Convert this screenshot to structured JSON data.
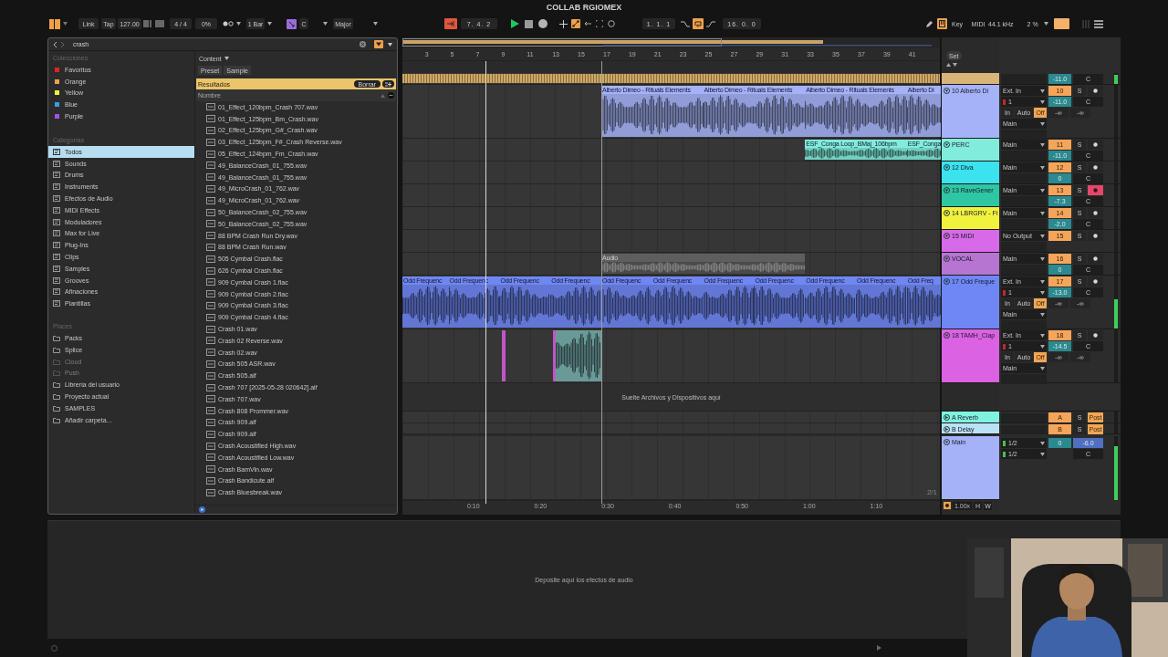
{
  "window": {
    "title": "COLLAB RGIOMEX"
  },
  "toolbar": {
    "link": "Link",
    "tap": "Tap",
    "tempo": "127.00",
    "signature": "4 / 4",
    "groove": "0%",
    "quantization": "1 Bar",
    "key": "C",
    "scale": "Major",
    "position": "7. 4. 2",
    "playing": true,
    "loop_start": "1. 1. 1",
    "loop_on": true,
    "loop_length": "16. 0. 0",
    "key_map": "Key",
    "key_map_on": true,
    "midi_map": "MIDI",
    "sample_rate": "44.1 kHz",
    "cpu": "2 %"
  },
  "browser": {
    "search": "crash",
    "collections_label": "Colecciones",
    "collections": [
      {
        "label": "Favoritos",
        "color": "#e02424"
      },
      {
        "label": "Orange",
        "color": "#f0a24a"
      },
      {
        "label": "Yellow",
        "color": "#f2f23c"
      },
      {
        "label": "Blue",
        "color": "#3a9de2"
      },
      {
        "label": "Purple",
        "color": "#a452e6"
      }
    ],
    "categories_label": "Categorías",
    "categories": [
      {
        "label": "Todos",
        "selected": true
      },
      {
        "label": "Sounds",
        "selected": false
      },
      {
        "label": "Drums",
        "selected": false
      },
      {
        "label": "Instruments",
        "selected": false
      },
      {
        "label": "Efectos de Audio",
        "selected": false
      },
      {
        "label": "MIDI Effects",
        "selected": false
      },
      {
        "label": "Moduladores",
        "selected": false
      },
      {
        "label": "Max for Live",
        "selected": false
      },
      {
        "label": "Plug-Ins",
        "selected": false
      },
      {
        "label": "Clips",
        "selected": false
      },
      {
        "label": "Samples",
        "selected": false
      },
      {
        "label": "Grooves",
        "selected": false
      },
      {
        "label": "Afinaciones",
        "selected": false
      },
      {
        "label": "Plantillas",
        "selected": false
      }
    ],
    "places_label": "Places",
    "places": [
      {
        "label": "Packs",
        "disabled": false
      },
      {
        "label": "Splice",
        "disabled": false
      },
      {
        "label": "Cloud",
        "disabled": true
      },
      {
        "label": "Push",
        "disabled": true
      },
      {
        "label": "Librería del usuario",
        "disabled": false
      },
      {
        "label": "Proyecto actual",
        "disabled": false
      },
      {
        "label": "SAMPLES",
        "disabled": false
      },
      {
        "label": "Añadir carpeta...",
        "disabled": false
      }
    ],
    "content_label": "Content",
    "filters": [
      "Preset",
      "Sample"
    ],
    "results_label": "Resultados",
    "clear_button": "Borrar",
    "column": "Nombre",
    "files": [
      "01_Effect_120bpm_Crash 707.wav",
      "01_Effect_125bpm_Bm_Crash.wav",
      "02_Effect_125bpm_G#_Crash.wav",
      "03_Effect_125bpm_F#_Crash Reverse.wav",
      "05_Effect_124bpm_Fm_Crash.wav",
      "49_BalanceCrash_01_755.wav",
      "49_BalanceCrash_01_755.wav",
      "49_MicroCrash_01_762.wav",
      "49_MicroCrash_01_762.wav",
      "50_BalanceCrash_02_755.wav",
      "50_BalanceCrash_02_755.wav",
      "88 BPM Crash Run Dry.wav",
      "88 BPM Crash Run.wav",
      "505 Cymbal Crash.flac",
      "626 Cymbal Crash.flac",
      "909 Cymbal Crash 1.flac",
      "909 Cymbal Crash 2.flac",
      "909 Cymbal Crash 3.flac",
      "909 Cymbal Crash 4.flac",
      "Crash 01.wav",
      "Crash 02 Reverse.wav",
      "Crash 02.wav",
      "Crash 505 ASR.wav",
      "Crash 505.aif",
      "Crash 707 [2025-05-28 020642].aif",
      "Crash 707.wav",
      "Crash 808 Prommer.wav",
      "Crash 909.aif",
      "Crash 909.aif",
      "Crash Acoustified High.wav",
      "Crash Acoustified Low.wav",
      "Crash BamVin.wav",
      "Crash Bandicute.aif",
      "Crash Bluesbreak.wav"
    ]
  },
  "arrangement": {
    "set_button": "Set",
    "bars": [
      "3",
      "5",
      "7",
      "9",
      "11",
      "13",
      "15",
      "17",
      "19",
      "21",
      "23",
      "25",
      "27",
      "29",
      "31",
      "33",
      "35",
      "37",
      "39",
      "41"
    ],
    "times": [
      "0:10",
      "0:20",
      "0:30",
      "0:40",
      "0:50",
      "1:00",
      "1:10"
    ],
    "drop_hint": "Suelte Archivos y Dispositivos aquí",
    "page": "2/1",
    "zoom": "1.00x",
    "h_button": "H",
    "w_button": "W"
  },
  "group": {
    "color": "#d9b377",
    "volume": "-11.0",
    "pan": "C",
    "level": 0.8
  },
  "tracks": [
    {
      "name": "10 Alberto Di",
      "color": "#a5b2f7",
      "kind": "expanded",
      "input": "Ext. In",
      "channel": "1",
      "monitor": [
        {
          "label": "In",
          "selected": false
        },
        {
          "label": "Auto",
          "selected": false
        },
        {
          "label": "Off",
          "selected": true
        }
      ],
      "output": "Main",
      "number": "10",
      "solo": "S",
      "volume": "-11.0",
      "pan": "C",
      "sends": [
        "-∞",
        "-∞"
      ],
      "armed": false,
      "clips": [
        {
          "name": "Alberto Dimeo - Rituals Elements",
          "active": true
        },
        {
          "name": "Alberto Dimeo - Rituals Elements",
          "active": true
        },
        {
          "name": "Alberto Dimeo - Rituals Elements",
          "active": true
        },
        {
          "name": "Alberto Di",
          "active": true
        }
      ]
    },
    {
      "name": "PERC",
      "color": "#82ecdc",
      "kind": "compact",
      "output": "Main",
      "number": "11",
      "solo": "S",
      "volume": "-11.0",
      "pan": "C",
      "armed": false,
      "clips": [
        {
          "name": "ESF_Conga Loop_BMaj_106bpm",
          "active": true
        },
        {
          "name": "ESF_Conga",
          "active": true
        }
      ]
    },
    {
      "name": "12 Diva",
      "color": "#3ae3ee",
      "kind": "compact",
      "output": "Main",
      "number": "12",
      "solo": "S",
      "volume": "0",
      "pan": "C",
      "armed": false
    },
    {
      "name": "13 RaveGener",
      "color": "#2fc6a4",
      "kind": "compact",
      "output": "Main",
      "number": "13",
      "solo": "S",
      "volume": "-7.3",
      "pan": "C",
      "armed": true
    },
    {
      "name": "14 LBRGRV - Fi",
      "color": "#f1f23e",
      "kind": "compact",
      "output": "Main",
      "number": "14",
      "solo": "S",
      "volume": "-2.0",
      "pan": "C",
      "armed": false
    },
    {
      "name": "15 MIDI",
      "color": "#d66ae8",
      "kind": "compact",
      "output": "No Output",
      "number": "15",
      "solo": "S",
      "armed": false
    },
    {
      "name": "VOCAL",
      "color": "#b675d1",
      "kind": "compact",
      "output": "Main",
      "number": "16",
      "solo": "S",
      "volume": "0",
      "pan": "C",
      "armed": false,
      "clips": [
        {
          "name": "Audio",
          "active": false
        }
      ]
    },
    {
      "name": "17 Odd Freque",
      "color": "#6f87f2",
      "kind": "expanded",
      "input": "Ext. In",
      "channel": "1",
      "monitor": [
        {
          "label": "In",
          "selected": false
        },
        {
          "label": "Auto",
          "selected": false
        },
        {
          "label": "Off",
          "selected": true
        }
      ],
      "output": "Main",
      "number": "17",
      "solo": "S",
      "volume": "-13.0",
      "pan": "C",
      "sends": [
        "-∞",
        "-∞"
      ],
      "armed": false,
      "level": 0.55,
      "clips": [
        {
          "name": "Odd Frequenc",
          "active": true
        },
        {
          "name": "Odd Frequenc",
          "active": true
        },
        {
          "name": "Odd Frequenc",
          "active": true
        },
        {
          "name": "Odd Frequenc",
          "active": true
        },
        {
          "name": "Odd Frequenc",
          "active": true
        },
        {
          "name": "Odd Frequenc",
          "active": true
        },
        {
          "name": "Odd Frequenc",
          "active": true
        },
        {
          "name": "Odd Frequenc",
          "active": true
        },
        {
          "name": "Odd Frequenc",
          "active": true
        },
        {
          "name": "Odd Frequenc",
          "active": true
        },
        {
          "name": "Odd Freq",
          "active": true
        }
      ]
    },
    {
      "name": "18 TAMH_Clap",
      "color": "#db62e2",
      "kind": "expanded",
      "input": "Ext. In",
      "channel": "1",
      "monitor": [
        {
          "label": "In",
          "selected": false
        },
        {
          "label": "Auto",
          "selected": false
        },
        {
          "label": "Off",
          "selected": true
        }
      ],
      "output": "Main",
      "number": "18",
      "solo": "S",
      "volume": "-14.5",
      "pan": "C",
      "sends": [
        "-∞",
        "-∞"
      ],
      "armed": false,
      "clips": [
        {
          "active": true
        },
        {
          "active": true
        },
        {
          "active": true,
          "color": "#6a9a98"
        }
      ]
    }
  ],
  "returns": [
    {
      "name": "A Reverb",
      "color": "#80f2df",
      "letter": "A",
      "solo": "S",
      "post": "Post"
    },
    {
      "name": "B Delay",
      "color": "#b9e2f6",
      "letter": "B",
      "solo": "S",
      "post": "Post"
    }
  ],
  "main": {
    "name": "Main",
    "color": "#a5b2f7",
    "outputs": [
      "1/2",
      "1/2"
    ],
    "volume": "0",
    "cue": "-6.0",
    "pan": "C",
    "level": 0.85
  },
  "device_drop_hint": "Deposite aquí los efectos de audio"
}
